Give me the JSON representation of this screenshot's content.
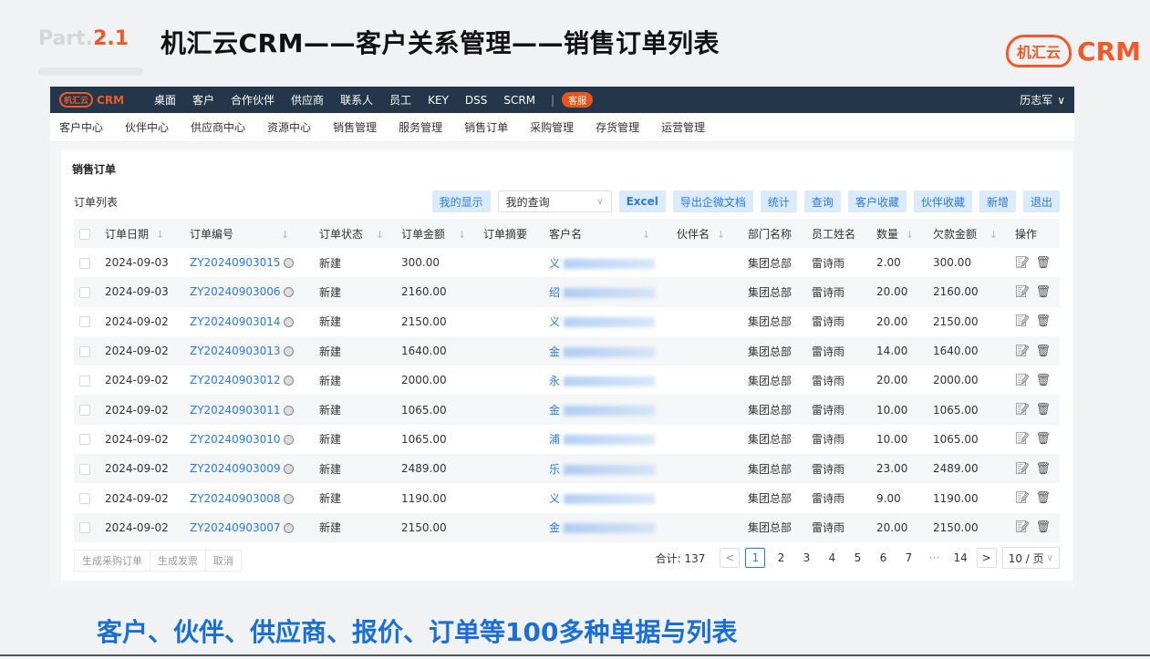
{
  "slide": {
    "part_prefix": "Part.",
    "part_num": "2.1",
    "title": "机汇云CRM——客户关系管理——销售订单列表",
    "brand_cloud": "机汇云",
    "brand_text": "CRM",
    "caption": "客户、伙伴、供应商、报价、订单等100多种单据与列表"
  },
  "topnav": {
    "logo_cloud": "机汇云",
    "logo_text": "CRM",
    "items": [
      "桌面",
      "客户",
      "合作伙伴",
      "供应商",
      "联系人",
      "员工",
      "KEY",
      "DSS",
      "SCRM"
    ],
    "separator": "|",
    "badge": "客服",
    "user": "历志军",
    "user_caret": "∨"
  },
  "subnav": [
    "客户中心",
    "伙伴中心",
    "供应商中心",
    "资源中心",
    "销售管理",
    "服务管理",
    "销售订单",
    "采购管理",
    "存货管理",
    "运营管理"
  ],
  "page": {
    "heading": "销售订单",
    "list_title": "订单列表"
  },
  "toolbar": {
    "my_view": "我的显示",
    "query_select": "我的查询",
    "buttons": [
      "Excel",
      "导出企微文档",
      "统计",
      "查询",
      "客户收藏",
      "伙伴收藏",
      "新增",
      "退出"
    ]
  },
  "table": {
    "headers": [
      "订单日期",
      "订单编号",
      "订单状态",
      "订单金额",
      "订单摘要",
      "客户名",
      "伙伴名",
      "部门名称",
      "员工姓名",
      "数量",
      "欠款金额",
      "操作"
    ],
    "rows": [
      {
        "date": "2024-09-03",
        "no": "ZY20240903015",
        "status": "新建",
        "amount": "300.00",
        "customer": "义",
        "dept": "集团总部",
        "staff": "雷诗雨",
        "qty": "2.00",
        "debt": "300.00"
      },
      {
        "date": "2024-09-03",
        "no": "ZY20240903006",
        "status": "新建",
        "amount": "2160.00",
        "customer": "绍",
        "dept": "集团总部",
        "staff": "雷诗雨",
        "qty": "20.00",
        "debt": "2160.00"
      },
      {
        "date": "2024-09-02",
        "no": "ZY20240903014",
        "status": "新建",
        "amount": "2150.00",
        "customer": "义",
        "dept": "集团总部",
        "staff": "雷诗雨",
        "qty": "20.00",
        "debt": "2150.00"
      },
      {
        "date": "2024-09-02",
        "no": "ZY20240903013",
        "status": "新建",
        "amount": "1640.00",
        "customer": "金",
        "dept": "集团总部",
        "staff": "雷诗雨",
        "qty": "14.00",
        "debt": "1640.00"
      },
      {
        "date": "2024-09-02",
        "no": "ZY20240903012",
        "status": "新建",
        "amount": "2000.00",
        "customer": "永",
        "dept": "集团总部",
        "staff": "雷诗雨",
        "qty": "20.00",
        "debt": "2000.00"
      },
      {
        "date": "2024-09-02",
        "no": "ZY20240903011",
        "status": "新建",
        "amount": "1065.00",
        "customer": "金",
        "dept": "集团总部",
        "staff": "雷诗雨",
        "qty": "10.00",
        "debt": "1065.00"
      },
      {
        "date": "2024-09-02",
        "no": "ZY20240903010",
        "status": "新建",
        "amount": "1065.00",
        "customer": "浦",
        "dept": "集团总部",
        "staff": "雷诗雨",
        "qty": "10.00",
        "debt": "1065.00"
      },
      {
        "date": "2024-09-02",
        "no": "ZY20240903009",
        "status": "新建",
        "amount": "2489.00",
        "customer": "乐",
        "dept": "集团总部",
        "staff": "雷诗雨",
        "qty": "23.00",
        "debt": "2489.00"
      },
      {
        "date": "2024-09-02",
        "no": "ZY20240903008",
        "status": "新建",
        "amount": "1190.00",
        "customer": "义",
        "dept": "集团总部",
        "staff": "雷诗雨",
        "qty": "9.00",
        "debt": "1190.00"
      },
      {
        "date": "2024-09-02",
        "no": "ZY20240903007",
        "status": "新建",
        "amount": "2150.00",
        "customer": "金",
        "dept": "集团总部",
        "staff": "雷诗雨",
        "qty": "20.00",
        "debt": "2150.00"
      }
    ]
  },
  "footer": {
    "buttons": [
      "生成采购订单",
      "生成发票",
      "取消"
    ],
    "total_label": "合计: 137",
    "pages": [
      "1",
      "2",
      "3",
      "4",
      "5",
      "6",
      "7",
      "···",
      "14"
    ],
    "prev": "<",
    "next": ">",
    "page_size": "10 / 页"
  },
  "colors": {
    "accent": "#2a7ae2",
    "brand": "#f05a28",
    "nav_bg": "#24364a"
  }
}
